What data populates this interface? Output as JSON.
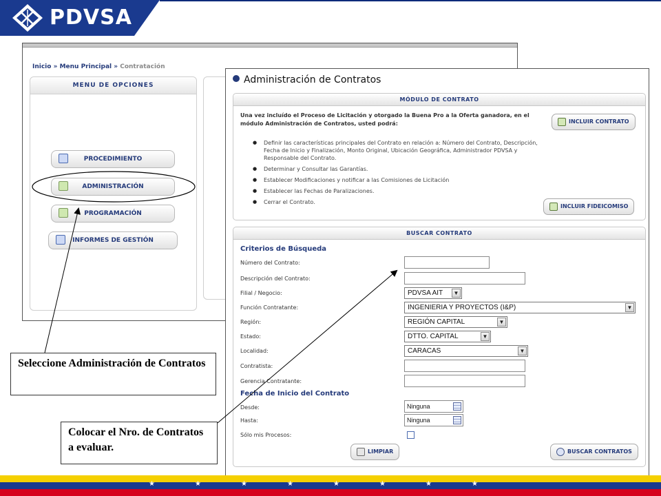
{
  "header": {
    "logo_text": "PDVSA",
    "colors": {
      "primary": "#1a3a8f",
      "accent": "#0d2a7a"
    },
    "logo_icon": "pdvsa-logo-icon"
  },
  "back_window": {
    "breadcrumb": {
      "home": "Inicio",
      "sep": "»",
      "menu": "Menu Principal",
      "current": "Contratación"
    },
    "menu": {
      "title": "MENU DE OPCIONES",
      "items": [
        {
          "label": "PROCEDIMIENTO",
          "icon": "document-icon"
        },
        {
          "label": "ADMINISTRACIÓN",
          "icon": "chart-icon"
        },
        {
          "label": "PROGRAMACIÓN",
          "icon": "chart-icon"
        },
        {
          "label": "INFORMES DE GESTIÓN",
          "icon": "report-icon"
        }
      ]
    }
  },
  "front_window": {
    "title": "Administración de Contratos",
    "modulo": {
      "title": "MÓDULO DE CONTRATO",
      "intro": "Una vez incluído el Proceso de Licitación y otorgado la Buena Pro a la Oferta ganadora, en el módulo Administración de Contratos, usted podrá:",
      "bullets": [
        "Definir las características principales del Contrato en relación a: Número del Contrato, Descripción, Fecha de Inicio y Finalización, Monto Original, Ubicación Geográfica, Administrador PDVSA y Responsable del Contrato.",
        "Determinar y Consultar las Garantías.",
        "Establecer Modificaciones y notificar a las Comisiones de Licitación",
        "Establecer las Fechas de Paralizaciones.",
        "Cerrar el Contrato."
      ],
      "btn_incluir_contrato": "INCLUIR CONTRATO",
      "btn_incluir_fideicomiso": "INCLUIR FIDEICOMISO"
    },
    "buscar": {
      "title": "BUSCAR CONTRATO",
      "criterios_title": "Criterios de Búsqueda",
      "labels": {
        "numero": "Número del Contrato:",
        "descripcion": "Descripción del Contrato:",
        "filial": "Filial / Negocio:",
        "funcion": "Función Contratante:",
        "region": "Región:",
        "estado": "Estado:",
        "localidad": "Localidad:",
        "contratista": "Contratista:",
        "gerencia": "Gerencia Contratante:"
      },
      "values": {
        "numero": "",
        "descripcion": "",
        "filial": "PDVSA AIT",
        "funcion": "INGENIERIA Y PROYECTOS (I&P)",
        "region": "REGIÓN CAPITAL",
        "estado": "DTTO. CAPITAL",
        "localidad": "CARACAS",
        "contratista": "",
        "gerencia": ""
      },
      "fecha_title": "Fecha de Inicio del Contrato",
      "desde_label": "Desde:",
      "hasta_label": "Hasta:",
      "desde_value": "Ninguna",
      "hasta_value": "Ninguna",
      "solo_label": "Sólo mis Procesos:",
      "btn_limpiar": "LIMPIAR",
      "btn_buscar": "BUSCAR CONTRATOS"
    }
  },
  "callouts": {
    "seleccione": "Seleccione Administración de Contratos",
    "colocar": "Colocar el Nro. de Contratos a evaluar."
  },
  "flag": {
    "yellow": "#f5d000",
    "blue": "#1a3a8f",
    "red": "#d6001c",
    "star": "★"
  }
}
